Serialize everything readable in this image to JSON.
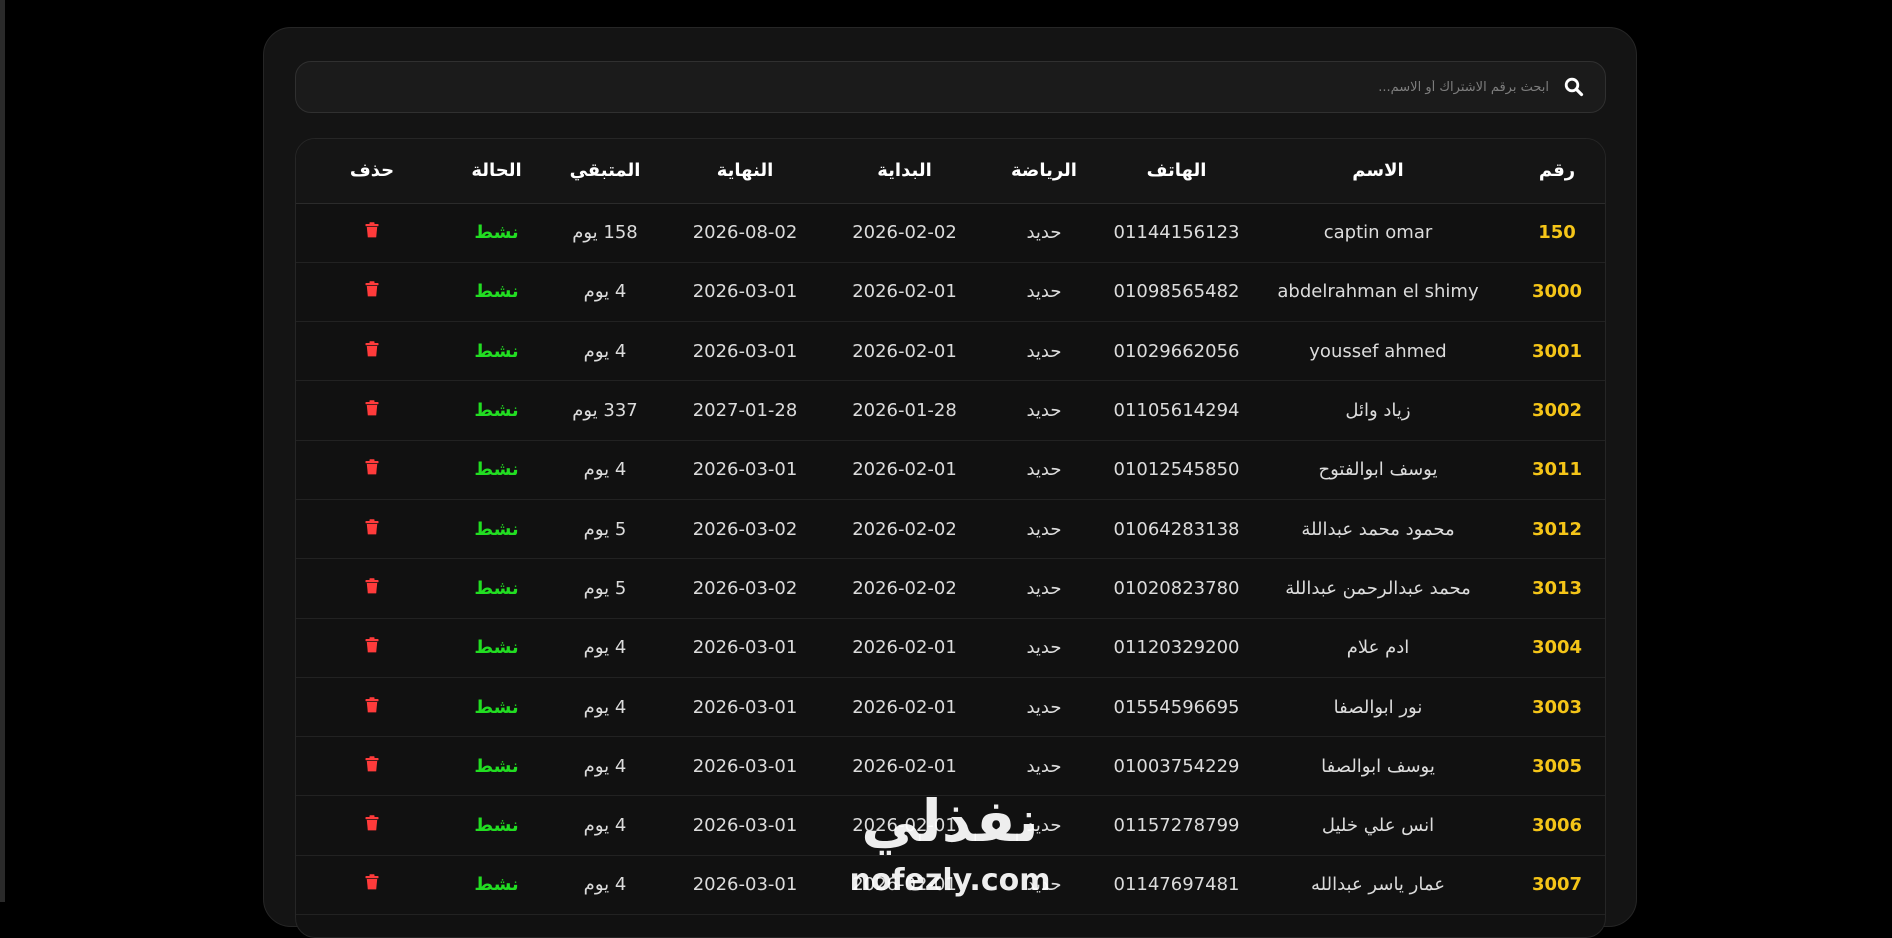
{
  "search": {
    "placeholder": "ابحث برقم الاشتراك أو الاسم..."
  },
  "colors": {
    "id": "#f5c518",
    "status": "#22dd22",
    "delete": "#ff3b3b"
  },
  "table": {
    "headers": {
      "id": "رقم",
      "name": "الاسم",
      "phone": "الهاتف",
      "sport": "الرياضة",
      "start": "البداية",
      "end": "النهاية",
      "remaining": "المتبقي",
      "status": "الحالة",
      "delete": "حذف"
    },
    "rows": [
      {
        "id": "150",
        "name": "captin omar",
        "phone": "01144156123",
        "sport": "حديد",
        "start": "2026-02-02",
        "end": "2026-08-02",
        "remaining": "158 يوم",
        "status": "نشط"
      },
      {
        "id": "3000",
        "name": "abdelrahman el shimy",
        "phone": "01098565482",
        "sport": "حديد",
        "start": "2026-02-01",
        "end": "2026-03-01",
        "remaining": "4 يوم",
        "status": "نشط"
      },
      {
        "id": "3001",
        "name": "youssef ahmed",
        "phone": "01029662056",
        "sport": "حديد",
        "start": "2026-02-01",
        "end": "2026-03-01",
        "remaining": "4 يوم",
        "status": "نشط"
      },
      {
        "id": "3002",
        "name": "زياد وائل",
        "phone": "01105614294",
        "sport": "حديد",
        "start": "2026-01-28",
        "end": "2027-01-28",
        "remaining": "337 يوم",
        "status": "نشط"
      },
      {
        "id": "3011",
        "name": "يوسف ابوالفتوح",
        "phone": "01012545850",
        "sport": "حديد",
        "start": "2026-02-01",
        "end": "2026-03-01",
        "remaining": "4 يوم",
        "status": "نشط"
      },
      {
        "id": "3012",
        "name": "محمود محمد عبداللة",
        "phone": "01064283138",
        "sport": "حديد",
        "start": "2026-02-02",
        "end": "2026-03-02",
        "remaining": "5 يوم",
        "status": "نشط"
      },
      {
        "id": "3013",
        "name": "محمد عبدالرحمن عبداللة",
        "phone": "01020823780",
        "sport": "حديد",
        "start": "2026-02-02",
        "end": "2026-03-02",
        "remaining": "5 يوم",
        "status": "نشط"
      },
      {
        "id": "3004",
        "name": "ادم علام",
        "phone": "01120329200",
        "sport": "حديد",
        "start": "2026-02-01",
        "end": "2026-03-01",
        "remaining": "4 يوم",
        "status": "نشط"
      },
      {
        "id": "3003",
        "name": "نور ابوالصفا",
        "phone": "01554596695",
        "sport": "حديد",
        "start": "2026-02-01",
        "end": "2026-03-01",
        "remaining": "4 يوم",
        "status": "نشط"
      },
      {
        "id": "3005",
        "name": "يوسف ابوالصفا",
        "phone": "01003754229",
        "sport": "حديد",
        "start": "2026-02-01",
        "end": "2026-03-01",
        "remaining": "4 يوم",
        "status": "نشط"
      },
      {
        "id": "3006",
        "name": "انس علي خليل",
        "phone": "01157278799",
        "sport": "حديد",
        "start": "2026-02-01",
        "end": "2026-03-01",
        "remaining": "4 يوم",
        "status": "نشط"
      },
      {
        "id": "3007",
        "name": "عمار ياسر عبدالله",
        "phone": "01147697481",
        "sport": "حديد",
        "start": "2026-02-01",
        "end": "2026-03-01",
        "remaining": "4 يوم",
        "status": "نشط"
      }
    ]
  },
  "watermark": {
    "arabic": "نفذلي",
    "latin": "nofezly.com"
  }
}
